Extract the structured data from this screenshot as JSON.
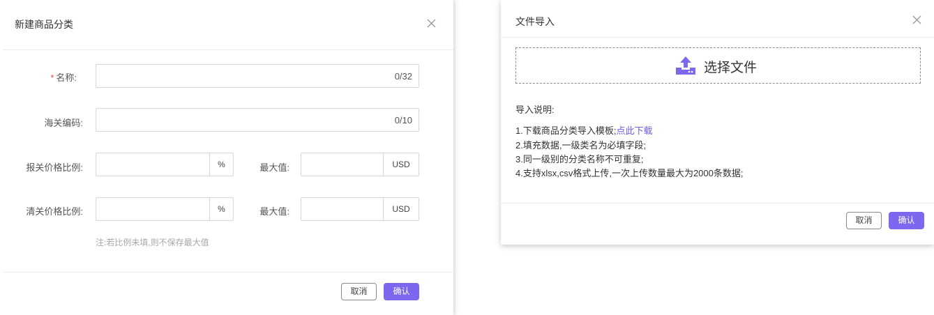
{
  "create_dialog": {
    "title": "新建商品分类",
    "fields": {
      "name": {
        "required_mark": "*",
        "label": "名称:",
        "value": "",
        "counter": "0/32"
      },
      "hs_code": {
        "label": "海关编码:",
        "value": "",
        "counter": "0/10"
      },
      "declare_ratio": {
        "label": "报关价格比例:",
        "value": "",
        "suffix": "%",
        "max_label": "最大值:",
        "max_value": "",
        "max_suffix": "USD"
      },
      "clear_ratio": {
        "label": "清关价格比例:",
        "value": "",
        "suffix": "%",
        "max_label": "最大值:",
        "max_value": "",
        "max_suffix": "USD"
      }
    },
    "note": "注:若比例未填,则不保存最大值",
    "cancel_label": "取消",
    "ok_label": "确认"
  },
  "import_dialog": {
    "title": "文件导入",
    "upload_label": "选择文件",
    "info_title": "导入说明:",
    "line1_text": "1.下载商品分类导入模板;",
    "line1_link": "点此下载",
    "line2": "2.填充数据,一级类名为必填字段;",
    "line3": "3.同一级别的分类名称不可重复;",
    "line4": "4.支持xlsx,csv格式上传,一次上传数量最大为2000条数据;",
    "cancel_label": "取消",
    "ok_label": "确认"
  },
  "colors": {
    "accent": "#7b68ee",
    "required": "#e54848",
    "link": "#6c5ce7"
  },
  "icons": [
    "close-icon",
    "upload-icon"
  ]
}
